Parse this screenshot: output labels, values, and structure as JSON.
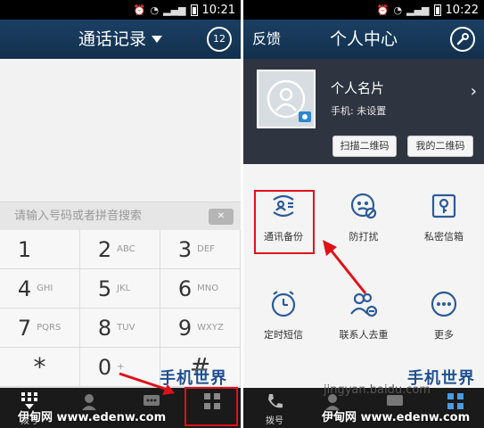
{
  "left_phone": {
    "status_time": "10:21",
    "title": "通话记录",
    "header_badge": "12",
    "search_placeholder": "请输入号码或者拼音搜索",
    "keys": [
      {
        "num": "1",
        "letters": ""
      },
      {
        "num": "2",
        "letters": "ABC"
      },
      {
        "num": "3",
        "letters": "DEF"
      },
      {
        "num": "4",
        "letters": "GHI"
      },
      {
        "num": "5",
        "letters": "JKL"
      },
      {
        "num": "6",
        "letters": "MNO"
      },
      {
        "num": "7",
        "letters": "PQRS"
      },
      {
        "num": "8",
        "letters": "TUV"
      },
      {
        "num": "9",
        "letters": "WXYZ"
      },
      {
        "num": "*",
        "letters": ""
      },
      {
        "num": "0",
        "letters": "+"
      },
      {
        "num": "#",
        "letters": ""
      }
    ],
    "tabs": {
      "dial": "拨号"
    }
  },
  "right_phone": {
    "status_time": "10:22",
    "feedback": "反馈",
    "title": "个人中心",
    "card": {
      "name": "个人名片",
      "phone": "手机: 未设置",
      "scan_button": "扫描二维码",
      "my_qr_button": "我的二维码"
    },
    "grid": [
      {
        "label": "通讯备份",
        "icon": "backup-icon"
      },
      {
        "label": "防打扰",
        "icon": "do-not-disturb-icon"
      },
      {
        "label": "私密信箱",
        "icon": "private-box-icon"
      },
      {
        "label": "定时短信",
        "icon": "timer-sms-icon"
      },
      {
        "label": "联系人去重",
        "icon": "dedupe-contacts-icon"
      },
      {
        "label": "更多",
        "icon": "more-icon"
      }
    ],
    "tabs": {
      "dial": "拨号"
    }
  },
  "watermark": {
    "site_text": "伊甸网 www.edenw.com",
    "logo": "手机世界",
    "baidu": "jingyan.baidu.com"
  },
  "colors": {
    "header": "#163a5c",
    "highlight": "#e0101a",
    "icon_blue": "#2c5b9a"
  }
}
